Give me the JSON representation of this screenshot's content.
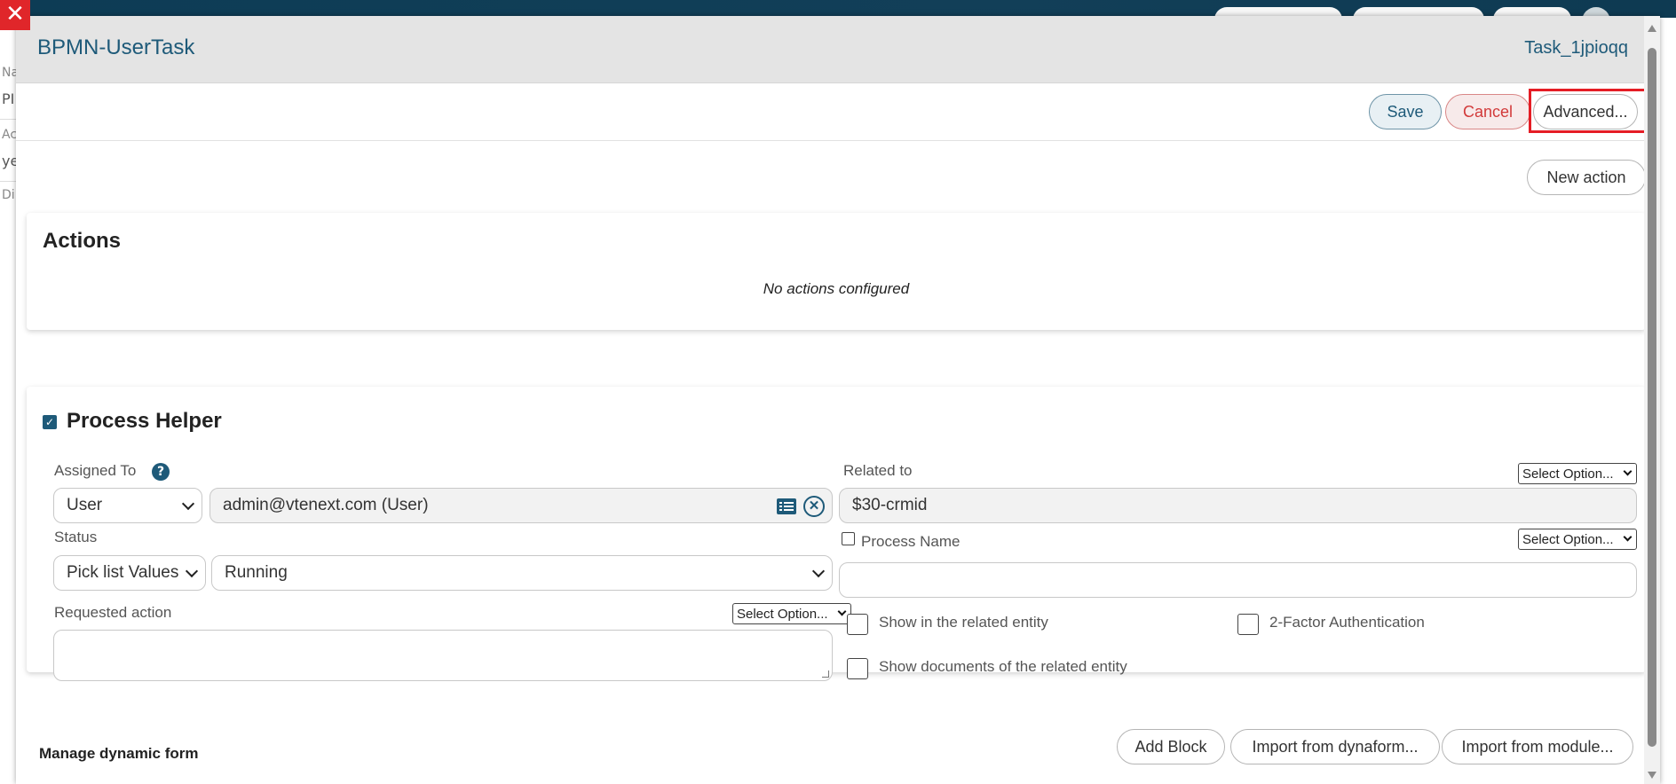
{
  "background": {
    "close_symbol": "✕",
    "left_fragments": [
      "Na",
      "PI",
      "Ac",
      "ye",
      "Di"
    ]
  },
  "modal": {
    "title": "BPMN-UserTask",
    "task_id": "Task_1jpioqq"
  },
  "toolbar": {
    "save_label": "Save",
    "cancel_label": "Cancel",
    "advanced_label": "Advanced..."
  },
  "new_action_label": "New action",
  "actions": {
    "title": "Actions",
    "empty_text": "No actions configured"
  },
  "process_helper": {
    "title": "Process Helper",
    "enabled": true,
    "assigned_to": {
      "label": "Assigned To",
      "help_symbol": "?",
      "type_value": "User",
      "user_value": "admin@vtenext.com (User)"
    },
    "related_to": {
      "label": "Related to",
      "select_label": "Select Option...",
      "value": "$30-crmid"
    },
    "status": {
      "label": "Status",
      "source_value": "Pick list Values",
      "value": "Running"
    },
    "process_name": {
      "label": "Process Name",
      "select_label": "Select Option...",
      "value": ""
    },
    "requested_action": {
      "label": "Requested action",
      "select_label": "Select Option..."
    },
    "show_related_entity": "Show in the related entity",
    "two_factor": "2-Factor Authentication",
    "show_documents": "Show documents of the related entity"
  },
  "dynamic_form": {
    "title": "Manage dynamic form",
    "add_block_label": "Add Block",
    "import_dynaform_label": "Import from dynaform...",
    "import_module_label": "Import from module..."
  },
  "colors": {
    "accent": "#1e5a79",
    "cancel": "#d23a3a",
    "highlight": "#e51d25"
  }
}
